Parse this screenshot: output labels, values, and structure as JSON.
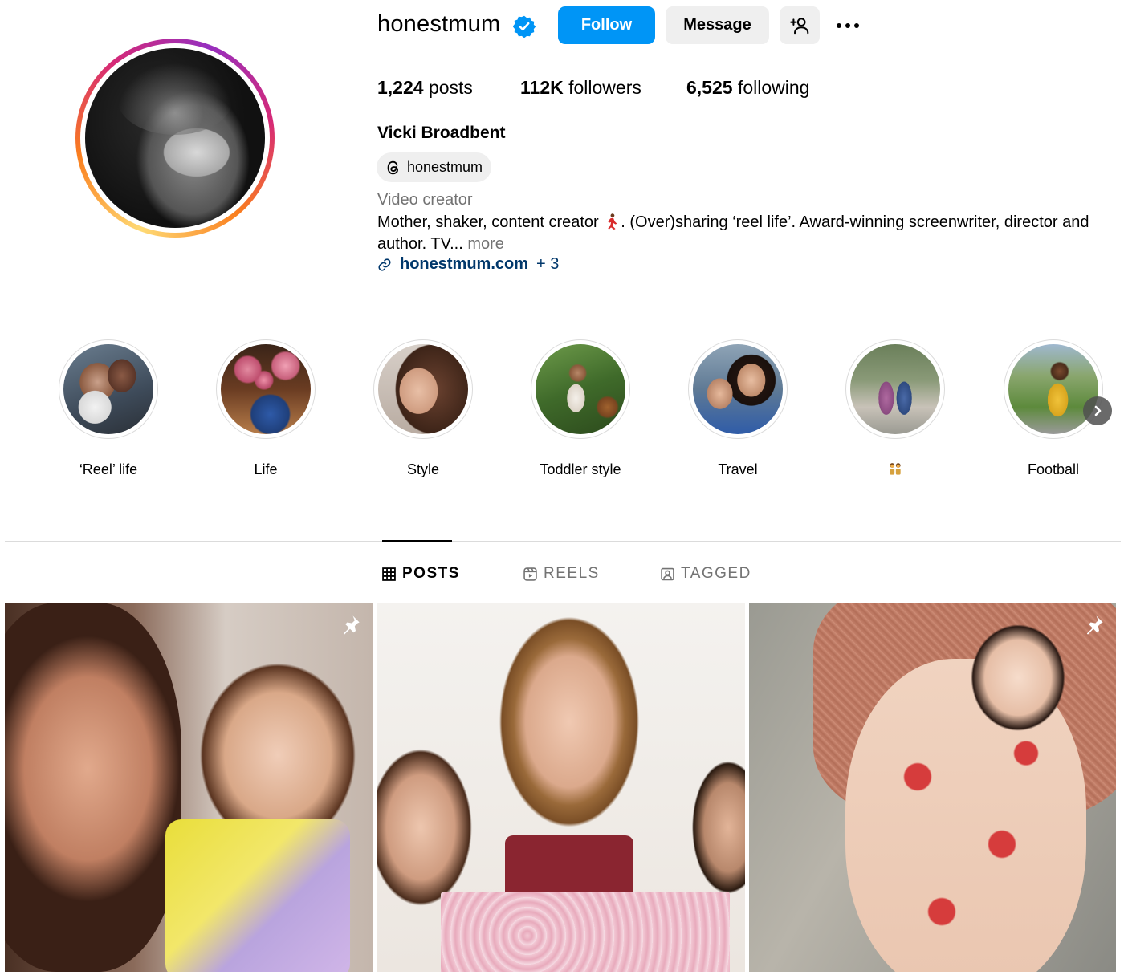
{
  "profile": {
    "username": "honestmum",
    "follow_label": "Follow",
    "message_label": "Message",
    "stats": {
      "posts_count": "1,224",
      "posts_label": " posts",
      "followers_count": "112K",
      "followers_label": " followers",
      "following_count": "6,525",
      "following_label": " following"
    },
    "full_name": "Vicki Broadbent",
    "threads_handle": "honestmum",
    "category": "Video creator",
    "bio_part1": "Mother, shaker, content creator ",
    "bio_part2": ". (Over)sharing ‘reel life’. Award-winning screenwriter, director and author. TV... ",
    "bio_more": "more",
    "link_text": "honestmum.com",
    "link_extra": "+ 3"
  },
  "highlights": [
    {
      "label": "‘Reel’ life"
    },
    {
      "label": "Life"
    },
    {
      "label": "Style"
    },
    {
      "label": "Toddler style"
    },
    {
      "label": "Travel"
    },
    {
      "label": ""
    },
    {
      "label": "Football"
    }
  ],
  "tabs": {
    "posts": "POSTS",
    "reels": "REELS",
    "tagged": "TAGGED"
  },
  "colors": {
    "accent": "#0095f6",
    "link": "#00376b",
    "muted": "#737373",
    "button_bg": "#efefef"
  }
}
